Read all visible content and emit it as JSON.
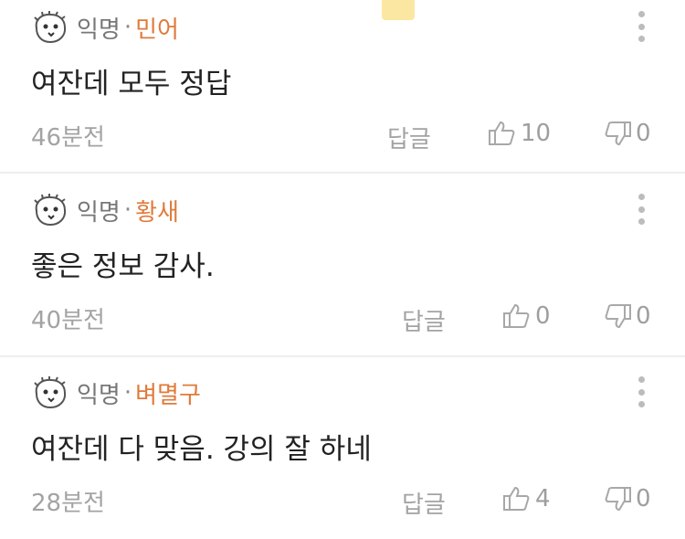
{
  "comments": [
    {
      "author": "익명",
      "separator": "·",
      "subject": "민어",
      "text": "여잔데 모두 정답",
      "time": "46분전",
      "reply_label": "답글",
      "likes": "10",
      "dislikes": "0"
    },
    {
      "author": "익명",
      "separator": "·",
      "subject": "황새",
      "text": "좋은 정보 감사.",
      "time": "40분전",
      "reply_label": "답글",
      "likes": "0",
      "dislikes": "0"
    },
    {
      "author": "익명",
      "separator": "·",
      "subject": "벼멸구",
      "text": "여잔데 다 맞음. 강의 잘 하네",
      "time": "28분전",
      "reply_label": "답글",
      "likes": "4",
      "dislikes": "0"
    }
  ],
  "colors": {
    "subject": "#e07a3a",
    "muted": "#a3a3a3",
    "text": "#222222"
  },
  "icons": {
    "avatar": "face-doodle-icon",
    "more": "more-vertical-icon",
    "like": "thumbs-up-icon",
    "dislike": "thumbs-down-icon"
  }
}
